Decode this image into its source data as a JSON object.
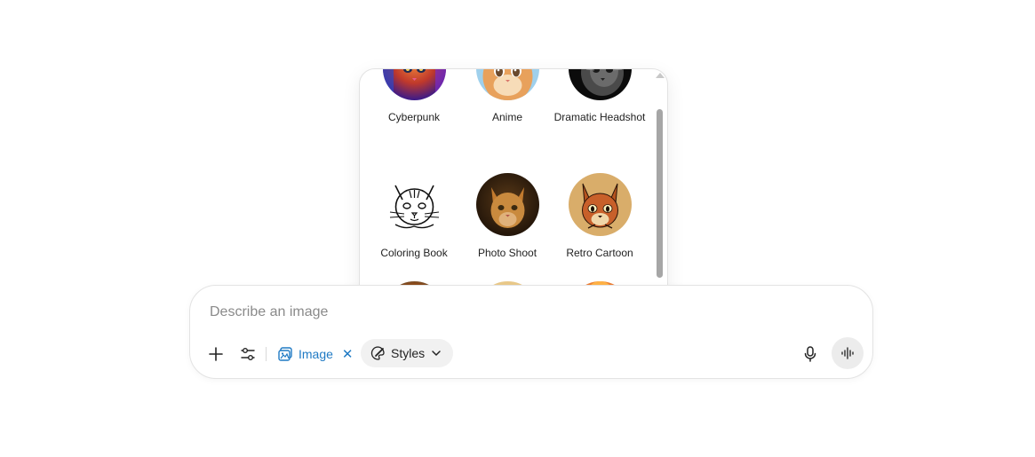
{
  "composer": {
    "placeholder": "Describe an image",
    "image_chip_label": "Image",
    "styles_button_label": "Styles",
    "icons": {
      "add": "plus-icon",
      "tools": "sliders-icon",
      "image": "image-icon",
      "remove": "close-icon",
      "styles": "palette-brush-icon",
      "dropdown": "chevron-down-icon",
      "mic": "microphone-icon",
      "voice": "voice-waveform-icon"
    },
    "accent_color": "#1f7ac4"
  },
  "styles_menu": {
    "items": [
      {
        "label": "Cyberpunk",
        "thumbnail": "cyberpunk-cat-portrait"
      },
      {
        "label": "Anime",
        "thumbnail": "anime-cat-portrait"
      },
      {
        "label": "Dramatic Headshot",
        "thumbnail": "dramatic-headshot-cat-portrait"
      },
      {
        "label": "Coloring Book",
        "thumbnail": "coloring-book-cat-portrait"
      },
      {
        "label": "Photo Shoot",
        "thumbnail": "photo-shoot-cat-portrait"
      },
      {
        "label": "Retro Cartoon",
        "thumbnail": "retro-cartoon-cat-portrait"
      },
      {
        "label": "",
        "thumbnail": "oil-painting-cat-portrait"
      },
      {
        "label": "",
        "thumbnail": "map-texture-cat-portrait"
      },
      {
        "label": "",
        "thumbnail": "synthwave-cat-portrait"
      }
    ]
  }
}
